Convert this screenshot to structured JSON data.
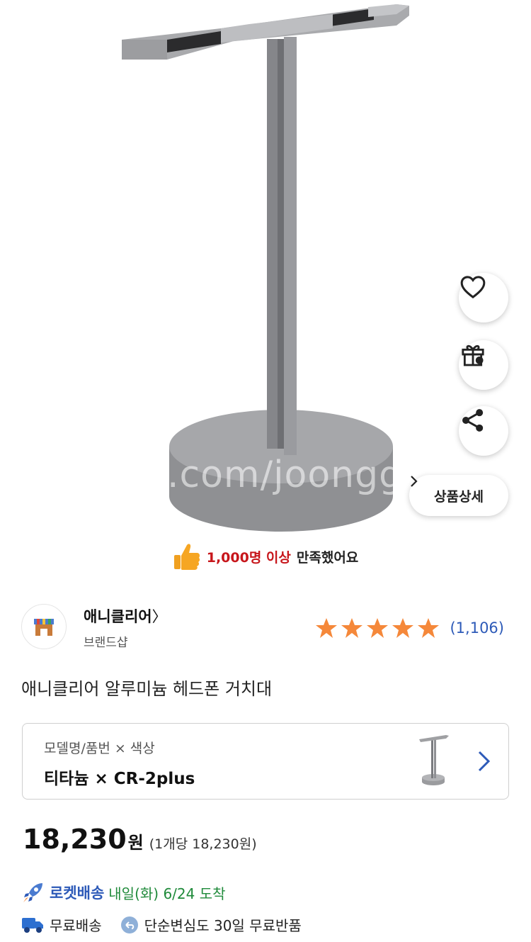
{
  "hero": {
    "watermark": ".com/joonggonara",
    "side_actions": [
      "heart-icon",
      "gift-icon",
      "share-icon"
    ],
    "detail_button_label": "상품상세"
  },
  "satisfaction": {
    "highlight": "1,000명 이상",
    "rest": "만족했어요"
  },
  "brand": {
    "name": "애니클리어",
    "subtitle": "브랜드샵",
    "rating_stars": 5,
    "review_count": "(1,106)"
  },
  "product": {
    "title": "애니클리어 알루미늄 헤드폰 거치대"
  },
  "option": {
    "label": "모델명/품번 × 색상",
    "value": "티타늄 × CR-2plus"
  },
  "price": {
    "amount": "18,230",
    "currency": "원",
    "unit_price": "(1개당 18,230원)"
  },
  "delivery": {
    "rocket_label": "로켓배송",
    "arrival": "내일(화) 6/24 도착",
    "free_shipping": "무료배송",
    "free_return": "단순변심도 30일 무료반품"
  },
  "colors": {
    "accent_blue": "#2d5ab8",
    "highlight_red": "#c7161b",
    "star_orange": "#f5883a",
    "arrival_green": "#1f8a3a"
  }
}
